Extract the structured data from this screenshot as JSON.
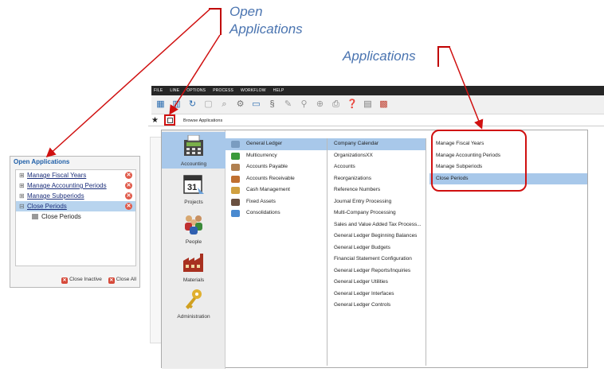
{
  "callouts": {
    "open_applications": [
      "Open",
      "Applications"
    ],
    "applications": "Applications"
  },
  "menu": [
    "FILE",
    "LINE",
    "OPTIONS",
    "PROCESS",
    "WORKFLOW",
    "HELP"
  ],
  "tab": {
    "browse_label": "Browse Applications"
  },
  "open_panel": {
    "title": "Open Applications",
    "items": [
      {
        "label": "Manage Fiscal Years",
        "expander": "⊞"
      },
      {
        "label": "Manage Accounting Periods",
        "expander": "⊞"
      },
      {
        "label": "Manage Subperiods",
        "expander": "⊞"
      },
      {
        "label": "Close Periods",
        "expander": "⊟",
        "selected": true
      }
    ],
    "child": "Close Periods",
    "close_inactive": "Close Inactive",
    "close_all": "Close All"
  },
  "categories": [
    {
      "label": "Accounting",
      "icon": "calculator-icon",
      "selected": true
    },
    {
      "label": "Projects",
      "icon": "calendar-icon"
    },
    {
      "label": "People",
      "icon": "people-icon"
    },
    {
      "label": "Materials",
      "icon": "factory-icon"
    },
    {
      "label": "Administration",
      "icon": "key-icon"
    }
  ],
  "modules": [
    {
      "label": "General Ledger",
      "selected": true,
      "color": "#7a9cc0"
    },
    {
      "label": "Multicurrency",
      "color": "#3a9a3a"
    },
    {
      "label": "Accounts Payable",
      "color": "#b08050"
    },
    {
      "label": "Accounts Receivable",
      "color": "#c07030"
    },
    {
      "label": "Cash Management",
      "color": "#d0a040"
    },
    {
      "label": "Fixed Assets",
      "color": "#6a5040"
    },
    {
      "label": "Consolidations",
      "color": "#4a8ad0"
    }
  ],
  "submodules": [
    {
      "label": "Company Calendar",
      "selected": true
    },
    {
      "label": "OrganizationsXX"
    },
    {
      "label": "Accounts"
    },
    {
      "label": "Reorganizations"
    },
    {
      "label": "Reference Numbers"
    },
    {
      "label": "Journal Entry Processing"
    },
    {
      "label": "Multi-Company Processing"
    },
    {
      "label": "Sales and Value Added Tax Process..."
    },
    {
      "label": "General Ledger Beginning Balances"
    },
    {
      "label": "General Ledger Budgets"
    },
    {
      "label": "Financial Statement Configuration"
    },
    {
      "label": "General Ledger Reports/Inquiries"
    },
    {
      "label": "General Ledger Utilities"
    },
    {
      "label": "General Ledger Interfaces"
    },
    {
      "label": "General Ledger Controls"
    }
  ],
  "applications": [
    {
      "label": "Manage Fiscal Years"
    },
    {
      "label": "Manage Accounting Periods"
    },
    {
      "label": "Manage Subperiods"
    },
    {
      "label": "Close Periods",
      "selected": true
    }
  ],
  "colors": {
    "accent": "#d01010",
    "selection": "#a8c8ea",
    "callout": "#4a74b0"
  }
}
